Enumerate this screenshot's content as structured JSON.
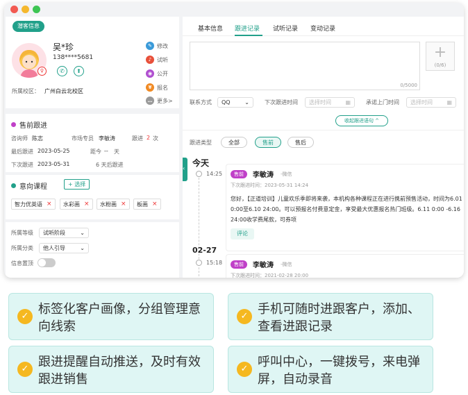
{
  "left": {
    "badge": "潜客信息",
    "customer": {
      "name": "吴*珍",
      "phone": "138****5681"
    },
    "campus_label": "所属校区：",
    "campus_value": "广州白云北校区",
    "actions": [
      {
        "label": "修改",
        "icon": "edit-icon",
        "color": "#3a9ad9"
      },
      {
        "label": "试听",
        "icon": "headphone-icon",
        "color": "#e8503a"
      },
      {
        "label": "公开",
        "icon": "eye-icon",
        "color": "#b04fd0"
      },
      {
        "label": "报名",
        "icon": "money-icon",
        "color": "#f08a24"
      },
      {
        "label": "更多>",
        "icon": "more-icon",
        "color": "#999999"
      }
    ],
    "presale": {
      "title": "售前跟进",
      "consultant_label": "咨询师",
      "consultant": "陈志",
      "market_label": "市场专员",
      "market": "李敏涛",
      "follow_label": "跟进",
      "follow_count": "2",
      "follow_unit": "次",
      "last_label": "最后跟进",
      "last_date": "2023-05-25",
      "distance_label": "距今",
      "distance_value": "--",
      "distance_unit": "天",
      "next_label": "下次跟进",
      "next_date": "2023-05-31",
      "next_after": "6 天后跟进"
    },
    "courses": {
      "title": "意向课程",
      "add_label": "+ 选择",
      "items": [
        "智力优英语",
        "水彩画",
        "水粉画",
        "板画"
      ]
    },
    "grade_label": "所属等级",
    "grade_value": "试听阶段",
    "category_label": "所属分类",
    "category_value": "他人引导",
    "pin_label": "信息置顶"
  },
  "right": {
    "tabs": [
      "基本信息",
      "跟进记录",
      "试听记录",
      "变动记录"
    ],
    "active_tab": 1,
    "textarea_counter": "0/5000",
    "upload_counter": "(0/6)",
    "contact_label": "联系方式",
    "contact_value": "QQ",
    "next_follow_label": "下次跟进时间",
    "next_follow_placeholder": "选择时间",
    "visit_label": "承诺上门时间",
    "visit_placeholder": "选择时间",
    "collapse_label": "收起跟进语句 ^",
    "type_label": "跟进类型",
    "type_options": [
      "全部",
      "售前",
      "售后"
    ],
    "timeline": [
      {
        "day": "今天",
        "time": "14:25",
        "badge": "售前",
        "name": "李敏涛",
        "channel": "-微信",
        "next": "下次跟进时间：2023-05-31 14:24",
        "content": "您好，【正道培训】儿童欢乐季即将来袭，本机构各种课程正在进行携前预售活动，时间为6.01 0:00至6.10 24:00。可以预报名付费意定金，享受最大优惠报名热门班级。6.11 0:00 -6.16 24:00收学费尾款，可券项",
        "comment": "评论"
      },
      {
        "day": "02-27",
        "time": "15:18",
        "badge": "售前",
        "name": "李敏涛",
        "channel": "-微信",
        "next": "下次跟进时间：2021-02-28 20:00"
      }
    ]
  },
  "features": [
    "标签化客户画像，分组管理意向线索",
    "手机可随时进跟客户，添加、查看进跟记录",
    "跟进提醒自动推送，及时有效跟进销售",
    "呼叫中心，一键拨号，来电弹屏，自动录音"
  ],
  "colors": {
    "accent": "#21a08a",
    "badge": "#c040c8",
    "check": "#f5b820"
  }
}
